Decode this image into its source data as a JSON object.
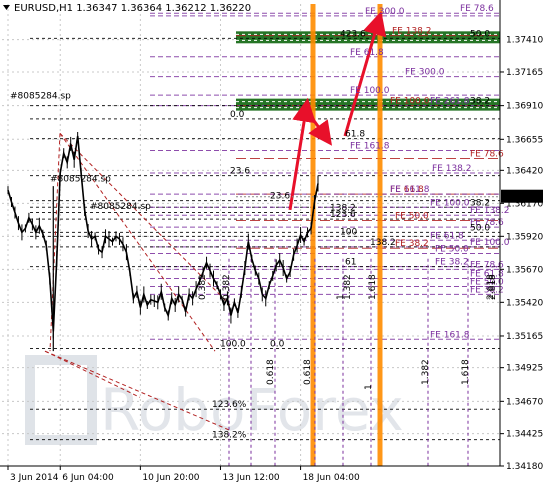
{
  "chart_data": {
    "type": "line",
    "title": "EURUSD,H1  1.36347 1.36364 1.36212 1.36220",
    "symbol": "EURUSD",
    "timeframe": "H1",
    "ohlc": {
      "open": "1.36347",
      "high": "1.36364",
      "low": "1.36212",
      "close": "1.36220"
    },
    "current_price": "1.36220",
    "ylim": [
      1.3418,
      1.3768
    ],
    "y_ticks": [
      "1.37165",
      "1.36910",
      "1.36655",
      "1.36420",
      "1.36170",
      "1.35920",
      "1.35670",
      "1.35420",
      "1.35165",
      "1.34925",
      "1.34670",
      "1.34425",
      "1.34180"
    ],
    "y_tick_values": [
      1.37165,
      1.3691,
      1.36655,
      1.3642,
      1.3617,
      1.3592,
      1.3567,
      1.3542,
      1.35165,
      1.34925,
      1.3467,
      1.34425,
      1.3418
    ],
    "top_tick": "1.37410",
    "top_tick_value": 1.3741,
    "x_ticks": [
      "3 Jun 2014",
      "6 Jun 04:00",
      "10 Jun 20:00",
      "13 Jun 12:00",
      "18 Jun 04:00"
    ],
    "x_tick_index": [
      0,
      15,
      38,
      61,
      84
    ],
    "grid": true,
    "watermark": "RoboForex",
    "series": [
      {
        "values": [
          1.3627,
          1.3618,
          1.361,
          1.3602,
          1.3595,
          1.3598,
          1.3606,
          1.3601,
          1.3595,
          1.36,
          1.3594,
          1.3585,
          1.356,
          1.352,
          1.3575,
          1.364,
          1.3655,
          1.3648,
          1.3662,
          1.365,
          1.3668,
          1.364,
          1.3612,
          1.3596,
          1.359,
          1.3592,
          1.3582,
          1.358,
          1.3592,
          1.359,
          1.3588,
          1.3592,
          1.359,
          1.3586,
          1.358,
          1.3565,
          1.3545,
          1.355,
          1.3538,
          1.3548,
          1.354,
          1.3544,
          1.3543,
          1.3542,
          1.355,
          1.3538,
          1.3532,
          1.3545,
          1.354,
          1.3548,
          1.3544,
          1.3535,
          1.3548,
          1.3545,
          1.3552,
          1.3558,
          1.3565,
          1.3572,
          1.3566,
          1.356,
          1.3555,
          1.3548,
          1.354,
          1.3545,
          1.3532,
          1.3542,
          1.3534,
          1.355,
          1.3568,
          1.3588,
          1.3575,
          1.3566,
          1.356,
          1.3548,
          1.3545,
          1.3555,
          1.3562,
          1.357,
          1.3574,
          1.3568,
          1.356,
          1.3565,
          1.3578,
          1.3585,
          1.3593,
          1.3588,
          1.3595,
          1.3598,
          1.3618,
          1.3632
        ]
      }
    ],
    "fib_zones": [
      {
        "text": "FE 300.0 / 423.6 / FE 138.2",
        "color": "#1a6e1a",
        "value": 1.3742
      },
      {
        "text": "FE 100.0 / 300 / FE 261.8",
        "color": "#1a6e1a",
        "value": 1.3691
      }
    ],
    "annotations": [
      {
        "text": "FE 78.6",
        "value": 1.3761,
        "color": "#7b2f9e"
      },
      {
        "text": "50.0",
        "value": 1.3742,
        "color": "#000000"
      },
      {
        "text": "423.6",
        "value": 1.3742,
        "color": "#000000"
      },
      {
        "text": "FE 300.0",
        "value": 1.3759,
        "color": "#7b2f9e"
      },
      {
        "text": "FE 138.2",
        "value": 1.3744,
        "color": "#b22222"
      },
      {
        "text": "FE 61.8",
        "value": 1.3728,
        "color": "#7b2f9e"
      },
      {
        "text": "FE 300.0",
        "value": 1.3713,
        "color": "#7b2f9e"
      },
      {
        "text": "FE 100.0",
        "value": 1.3699,
        "color": "#7b2f9e"
      },
      {
        "text": "FE 100.0",
        "value": 1.3691,
        "color": "#b22222"
      },
      {
        "text": "FE 261.8",
        "value": 1.3691,
        "color": "#7b2f9e"
      },
      {
        "text": "38.2",
        "value": 1.3691,
        "color": "#000000"
      },
      {
        "text": "0.0",
        "value": 1.3681,
        "color": "#000000"
      },
      {
        "text": "61.8",
        "value": 1.3666,
        "color": "#000000"
      },
      {
        "text": "FE 161.8",
        "value": 1.3657,
        "color": "#7b2f9e"
      },
      {
        "text": "FE 78.6",
        "value": 1.3651,
        "color": "#b22222"
      },
      {
        "text": "FE 138.2",
        "value": 1.364,
        "color": "#7b2f9e"
      },
      {
        "text": "23.6",
        "value": 1.3638,
        "color": "#000000"
      },
      {
        "text": "FE 61.8",
        "value": 1.3624,
        "color": "#b22222"
      },
      {
        "text": "FE 161.8",
        "value": 1.3624,
        "color": "#7b2f9e"
      },
      {
        "text": "23.6",
        "value": 1.3619,
        "color": "#000000"
      },
      {
        "text": "38.2",
        "value": 1.3614,
        "color": "#000000"
      },
      {
        "text": "FE 100.0",
        "value": 1.3614,
        "color": "#7b2f9e"
      },
      {
        "text": "138.2",
        "value": 1.361,
        "color": "#000000"
      },
      {
        "text": "FE 138.2",
        "value": 1.3608,
        "color": "#7b2f9e"
      },
      {
        "text": "123.6",
        "value": 1.3605,
        "color": "#000000"
      },
      {
        "text": "FE 50.0",
        "value": 1.3604,
        "color": "#b22222"
      },
      {
        "text": "FE 78.6",
        "value": 1.3599,
        "color": "#7b2f9e"
      },
      {
        "text": "50.0",
        "value": 1.3595,
        "color": "#000000"
      },
      {
        "text": "100",
        "value": 1.3592,
        "color": "#000000"
      },
      {
        "text": "FE 61.8",
        "value": 1.3589,
        "color": "#7b2f9e"
      },
      {
        "text": "FE 38.2",
        "value": 1.3583,
        "color": "#b22222"
      },
      {
        "text": "FE 100.0",
        "value": 1.3584,
        "color": "#7b2f9e"
      },
      {
        "text": "138.2",
        "value": 1.3584,
        "color": "#000000"
      },
      {
        "text": "FE 50.0",
        "value": 1.3579,
        "color": "#7b2f9e"
      },
      {
        "text": "FE 38.2",
        "value": 1.3569,
        "color": "#7b2f9e"
      },
      {
        "text": "61",
        "value": 1.3569,
        "color": "#000000"
      },
      {
        "text": "FE 78.6",
        "value": 1.3567,
        "color": "#7b2f9e"
      },
      {
        "text": "FE 61.8",
        "value": 1.356,
        "color": "#7b2f9e"
      },
      {
        "text": "FE 50.0",
        "value": 1.3554,
        "color": "#7b2f9e"
      },
      {
        "text": "FE 38.2",
        "value": 1.3548,
        "color": "#7b2f9e"
      },
      {
        "text": "FE 161.8",
        "value": 1.3514,
        "color": "#7b2f9e"
      },
      {
        "text": "0.0",
        "value": 1.3507,
        "color": "#000000"
      },
      {
        "text": "100.0",
        "value": 1.3507,
        "color": "#000000"
      },
      {
        "text": "123.6%",
        "value": 1.3461,
        "color": "#000000"
      },
      {
        "text": "138.2%",
        "value": 1.3438,
        "color": "#000000"
      },
      {
        "text": "#8085284.sp",
        "value": 1.3695,
        "color": "#000000"
      },
      {
        "text": "#8085284.sp",
        "value": 1.3632,
        "color": "#000000"
      },
      {
        "text": "#8085284.sp",
        "value": 1.3611,
        "color": "#000000"
      }
    ],
    "vertical_labels": [
      {
        "text": "0.382",
        "color": "#000000"
      },
      {
        "text": "0.618",
        "color": "#000000"
      },
      {
        "text": "1.382",
        "color": "#000000"
      },
      {
        "text": "1.618",
        "color": "#000000"
      },
      {
        "text": "1",
        "color": "#000000"
      },
      {
        "text": "2.618",
        "color": "#000000"
      },
      {
        "text": "0.382",
        "color": "#000000"
      },
      {
        "text": "0.618",
        "color": "#000000"
      },
      {
        "text": "1",
        "color": "#000000"
      },
      {
        "text": "1.382",
        "color": "#000000"
      },
      {
        "text": "1.618",
        "color": "#000000"
      },
      {
        "text": "2.618",
        "color": "#000000"
      }
    ],
    "colors": {
      "background": "#ffffff",
      "price_line": "#000000",
      "grid": "#c8c8c8",
      "fib_line_black": "#000000",
      "fib_line_purple": "#7b2f9e",
      "fib_line_red": "#b22222",
      "time_zone": "#ff8c00",
      "arrow": "#e8102a",
      "zone_fill": "#1a6e1a",
      "watermark": "#e2e5ea",
      "current_price_box": "#000000"
    }
  }
}
